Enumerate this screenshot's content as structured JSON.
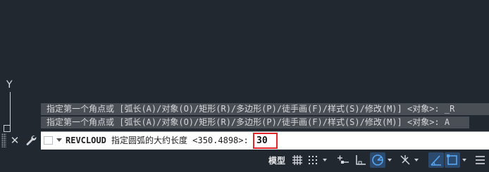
{
  "canvas": {
    "ucs_y_label": "Y"
  },
  "command_history": [
    "指定第一个角点或 [弧长(A)/对象(O)/矩形(R)/多边形(P)/徒手画(F)/样式(S)/修改(M)] <对象>: _R",
    "指定第一个角点或 [弧长(A)/对象(O)/矩形(R)/多边形(P)/徒手画(F)/样式(S)/修改(M)] <对象>: A"
  ],
  "command_line": {
    "command_name": "REVCLOUD",
    "prompt": " 指定圆弧的大约长度 <350.4898>:",
    "input_value": "30",
    "highlight_color": "#e0262a"
  },
  "status_bar": {
    "model_label": "模型",
    "icons": [
      "grid-icon",
      "snap-mode-icon",
      "infer-constraints-icon",
      "ortho-mode-icon",
      "polar-tracking-icon",
      "isometric-drafting-icon",
      "object-snap-tracking-icon",
      "object-snap-icon",
      "customization-menu-icon"
    ],
    "active_color": "#3e8ddd"
  },
  "colors": {
    "background": "#212830",
    "history_bg": "#4a4f55"
  }
}
